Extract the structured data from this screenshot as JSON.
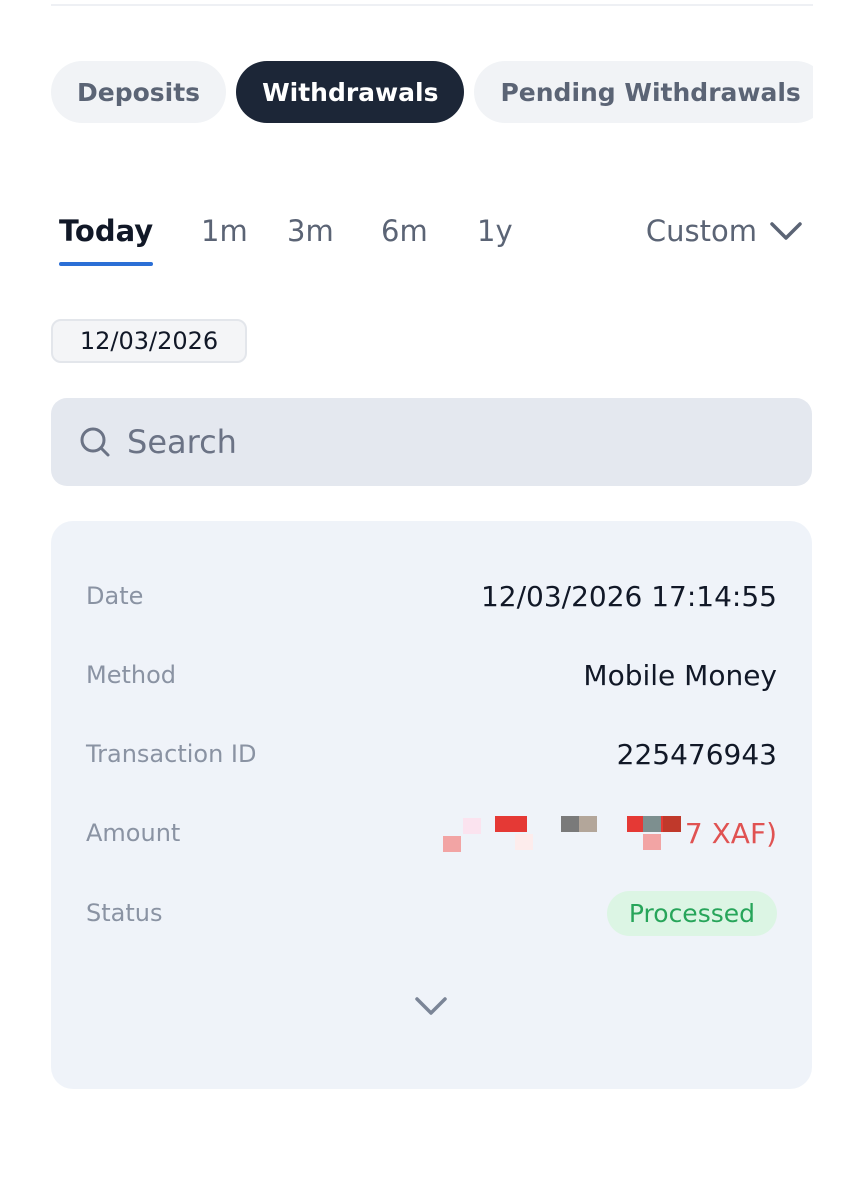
{
  "tabs": [
    {
      "label": "Deposits",
      "active": false
    },
    {
      "label": "Withdrawals",
      "active": true
    },
    {
      "label": "Pending Withdrawals",
      "active": false
    }
  ],
  "periods": {
    "today": "Today",
    "m1": "1m",
    "m3": "3m",
    "m6": "6m",
    "y1": "1y",
    "custom": "Custom"
  },
  "date_filter": "12/03/2026",
  "search": {
    "placeholder": "Search"
  },
  "transaction": {
    "date_label": "Date",
    "date_value": "12/03/2026 17:14:55",
    "method_label": "Method",
    "method_value": "Mobile Money",
    "id_label": "Transaction ID",
    "id_value": "225476943",
    "amount_label": "Amount",
    "amount_visible": "7 XAF)",
    "status_label": "Status",
    "status_value": "Processed"
  },
  "colors": {
    "active_tab_bg": "#1c2637",
    "underline": "#2b6fd6",
    "amount": "#e05252",
    "status_bg": "#dcf5e4",
    "status_text": "#27a55a"
  }
}
